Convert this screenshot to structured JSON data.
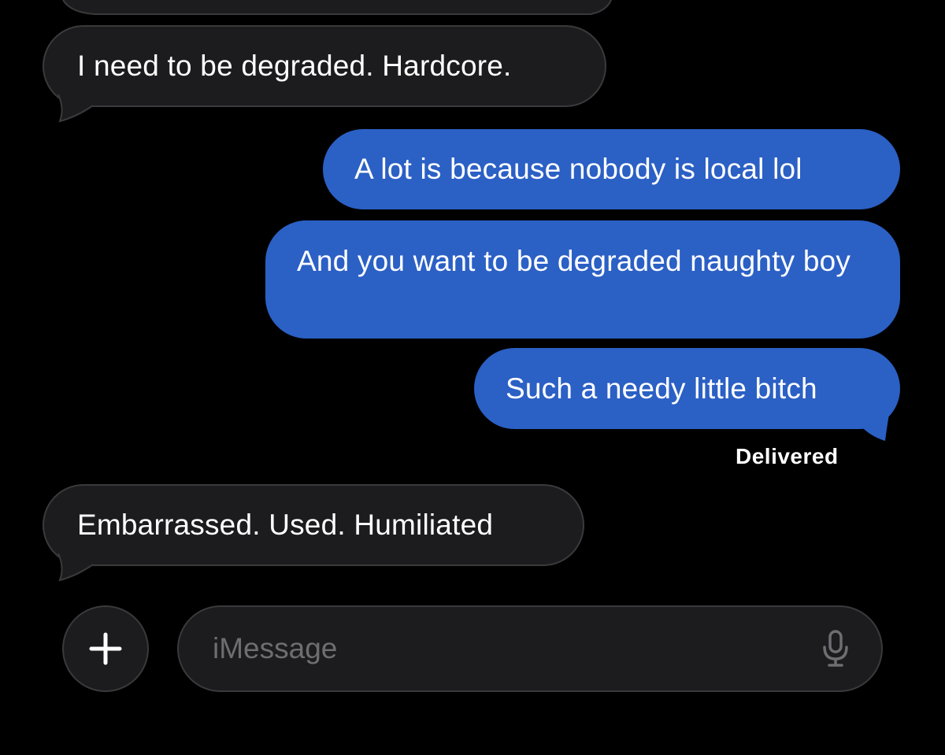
{
  "messages": [
    {
      "direction": "incoming",
      "text": "I need to be degraded. Hardcore."
    },
    {
      "direction": "outgoing",
      "text": "A lot is because nobody is local lol"
    },
    {
      "direction": "outgoing",
      "text": "And you want to be degraded naughty boy"
    },
    {
      "direction": "outgoing",
      "text": "Such a needy little bitch"
    },
    {
      "direction": "incoming",
      "text": "Embarrassed. Used. Humiliated"
    }
  ],
  "delivery_status": "Delivered",
  "composer": {
    "placeholder": "iMessage",
    "plus_icon": "plus-icon",
    "mic_icon": "microphone-icon"
  },
  "colors": {
    "background": "#000000",
    "incoming_bubble": "#1c1c1e",
    "incoming_border": "#3a3a3c",
    "outgoing_bubble": "#2b60c5",
    "text": "#ffffff",
    "placeholder": "#6d6d72"
  }
}
